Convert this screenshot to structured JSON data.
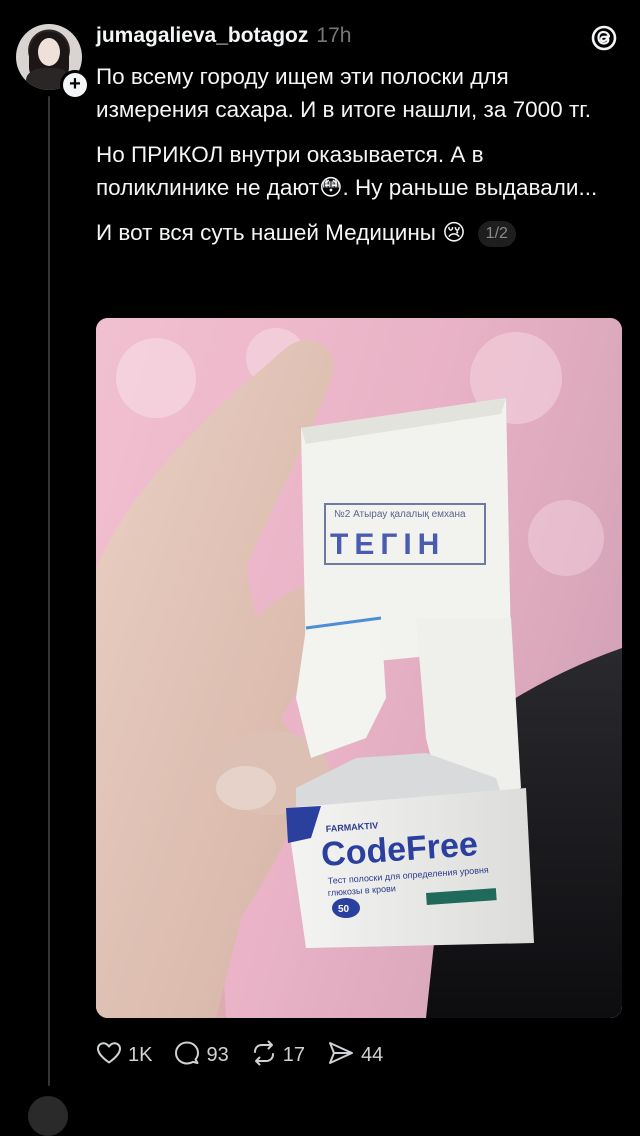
{
  "post": {
    "username": "jumagalieva_botagoz",
    "timestamp": "17h",
    "paragraphs": [
      "По всему городу ищем эти полоски для измерения сахара. И в итоге нашли, за 7000 тг.",
      "Но ПРИКОЛ внутри оказывается. А в поликлинике не дают😳. Ну раньше выдавали...",
      "И вот вся суть нашей Медицины 😢"
    ],
    "page_indicator": "1/2"
  },
  "photo": {
    "stamp_header": "№2 Атырау қалалық емхана",
    "stamp_word": "ТЕГІН",
    "brand_small": "FARMAKTIV",
    "brand": "CodeFree",
    "box_count": "50",
    "box_line_1": "Тест полоски для определения уровня",
    "box_line_2": "глюкозы в крови"
  },
  "actions": {
    "likes": "1K",
    "comments": "93",
    "reposts": "17",
    "shares": "44"
  },
  "icons": {
    "threads_logo": "threads-logo-icon",
    "like": "heart-icon",
    "comment": "comment-icon",
    "repost": "repost-icon",
    "share": "share-icon",
    "follow": "plus-icon"
  }
}
